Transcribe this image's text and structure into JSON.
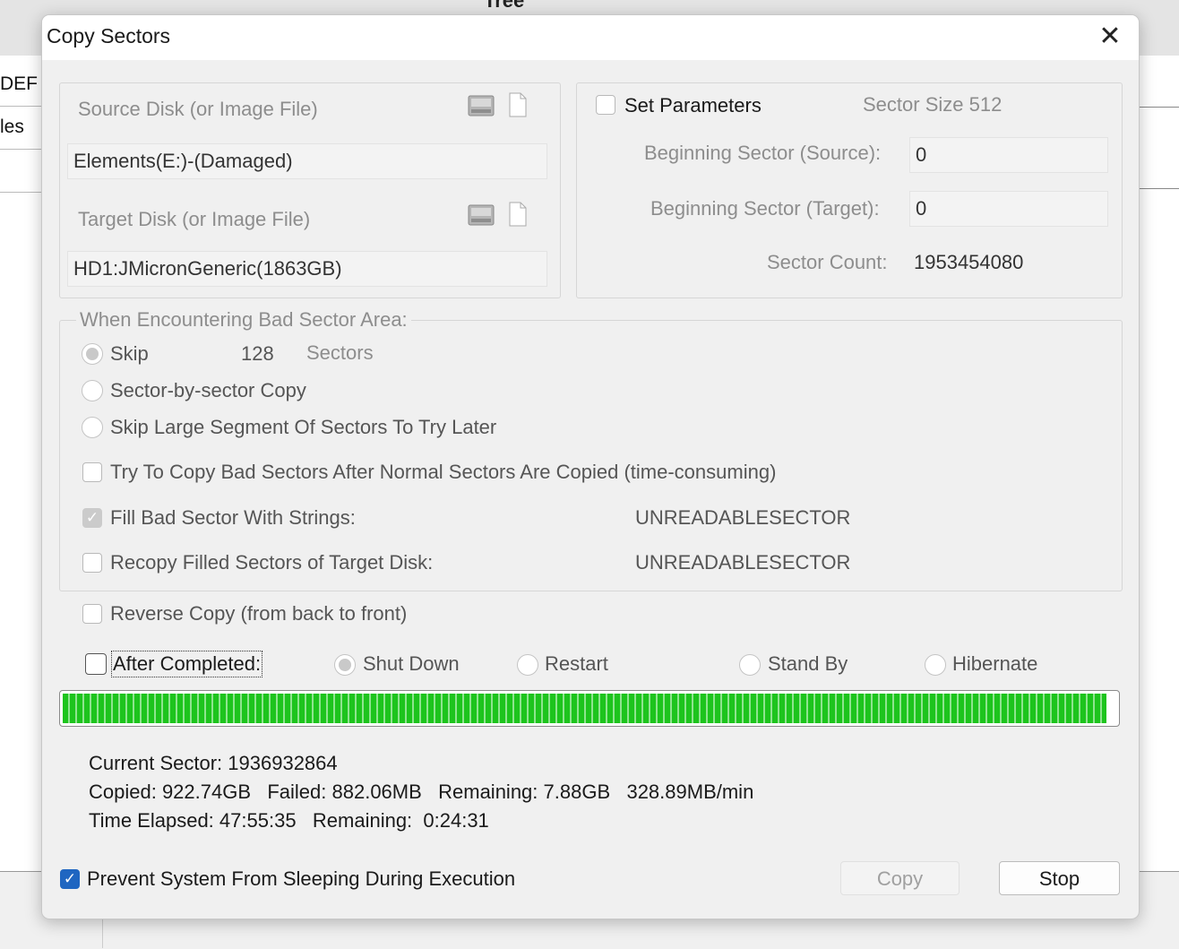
{
  "background": {
    "title": "Tree",
    "left_rows": [
      "DEF",
      "les"
    ]
  },
  "dialog": {
    "title": "Copy Sectors",
    "close_icon": "close-icon",
    "source": {
      "label": "Source Disk (or Image File)",
      "value": "Elements(E:)-(Damaged)"
    },
    "target": {
      "label": "Target Disk (or Image File)",
      "value": "HD1:JMicronGeneric(1863GB)"
    },
    "params": {
      "set_parameters_label": "Set Parameters",
      "set_parameters_checked": false,
      "sector_size": "Sector Size 512",
      "beginning_source_label": "Beginning Sector (Source):",
      "beginning_source_value": "0",
      "beginning_target_label": "Beginning Sector (Target):",
      "beginning_target_value": "0",
      "sector_count_label": "Sector Count:",
      "sector_count_value": "1953454080"
    },
    "bad_sector": {
      "group_label": "When Encountering Bad Sector Area:",
      "skip_label": "Skip",
      "skip_value": "128",
      "skip_unit": "Sectors",
      "sector_by_sector_label": "Sector-by-sector Copy",
      "skip_large_label": "Skip Large Segment Of Sectors To Try Later",
      "try_copy_label": "Try To Copy Bad Sectors After Normal Sectors Are Copied (time-consuming)",
      "fill_label": "Fill Bad Sector With Strings:",
      "fill_value": "UNREADABLESECTOR",
      "recopy_label": "Recopy Filled Sectors of Target Disk:",
      "recopy_value": "UNREADABLESECTOR"
    },
    "reverse_copy_label": "Reverse Copy (from back to front)",
    "after_completed": {
      "label": "After Completed:",
      "options": [
        "Shut Down",
        "Restart",
        "Stand By",
        "Hibernate"
      ]
    },
    "progress": {
      "fraction": 0.991,
      "color": "#1dc41d"
    },
    "status": {
      "current_sector": "Current Sector: 1936932864",
      "copied_line": "Copied: 922.74GB   Failed: 882.06MB   Remaining: 7.88GB   328.89MB/min",
      "time_line": "Time Elapsed: 47:55:35   Remaining:  0:24:31"
    },
    "prevent_sleep_label": "Prevent System From Sleeping During Execution",
    "prevent_sleep_checked": true,
    "copy_button": "Copy",
    "stop_button": "Stop"
  }
}
